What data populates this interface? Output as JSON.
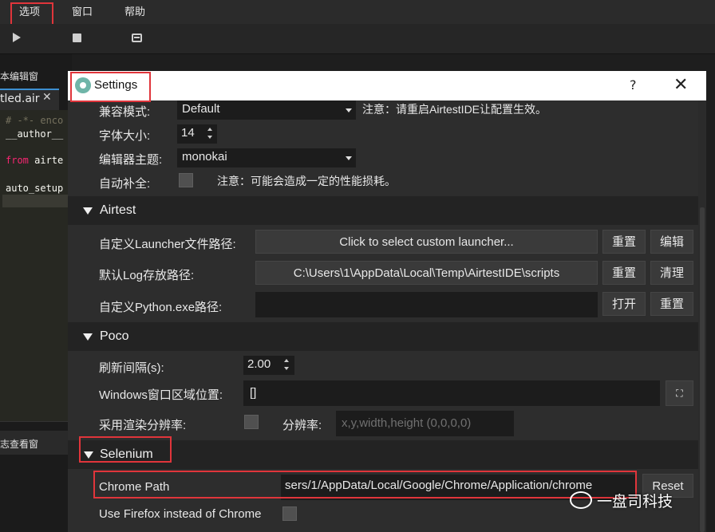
{
  "menubar": {
    "items": [
      {
        "label": "选项"
      },
      {
        "label": "窗口"
      },
      {
        "label": "帮助"
      }
    ]
  },
  "toolbar": {
    "icons": [
      "play-icon",
      "stop-icon",
      "list-icon"
    ]
  },
  "editor": {
    "pane_title": "本编辑窗",
    "tab_label": "tled.air",
    "tab_close": "✕",
    "code_lines": [
      "# -*- enco",
      "__author__",
      "from airte",
      "auto_setup"
    ]
  },
  "log_pane": {
    "title": "志查看窗"
  },
  "dialog": {
    "title": "Settings",
    "help": "?",
    "close": "✕",
    "general": {
      "compat_label": "兼容模式:",
      "compat_value": "Default",
      "compat_note": "注意：请重启AirtestIDE让配置生效。",
      "font_size_label": "字体大小:",
      "font_size_value": "14",
      "theme_label": "编辑器主题:",
      "theme_value": "monokai",
      "autocomplete_label": "自动补全:",
      "autocomplete_checked": false,
      "autocomplete_note": "注意：可能会造成一定的性能损耗。"
    },
    "airtest": {
      "title": "Airtest",
      "launcher_label": "自定义Launcher文件路径:",
      "launcher_button": "Click to select custom launcher...",
      "launcher_reset": "重置",
      "launcher_edit": "编辑",
      "log_label": "默认Log存放路径:",
      "log_value": "C:\\Users\\1\\AppData\\Local\\Temp\\AirtestIDE\\scripts",
      "log_reset": "重置",
      "log_clear": "清理",
      "python_label": "自定义Python.exe路径:",
      "python_value": "",
      "python_open": "打开",
      "python_reset": "重置"
    },
    "poco": {
      "title": "Poco",
      "refresh_label": "刷新间隔(s):",
      "refresh_value": "2.00",
      "window_label": "Windows窗口区域位置:",
      "window_value": "[]",
      "window_button": "⛶",
      "render_label": "采用渲染分辨率:",
      "render_checked": false,
      "resolution_label": "分辨率:",
      "resolution_placeholder": "x,y,width,height (0,0,0,0)"
    },
    "selenium": {
      "title": "Selenium",
      "chrome_label": "Chrome Path",
      "chrome_value": "sers/1/AppData/Local/Google/Chrome/Application/chrome",
      "chrome_reset": "Reset",
      "firefox_label": "Use Firefox instead of Chrome",
      "firefox_checked": false
    }
  },
  "watermark": {
    "text": "一盘司科技"
  },
  "colors": {
    "highlight": "#e0353b",
    "dialog_bg": "#2d2d2d",
    "accent": "#3d8fd1"
  }
}
